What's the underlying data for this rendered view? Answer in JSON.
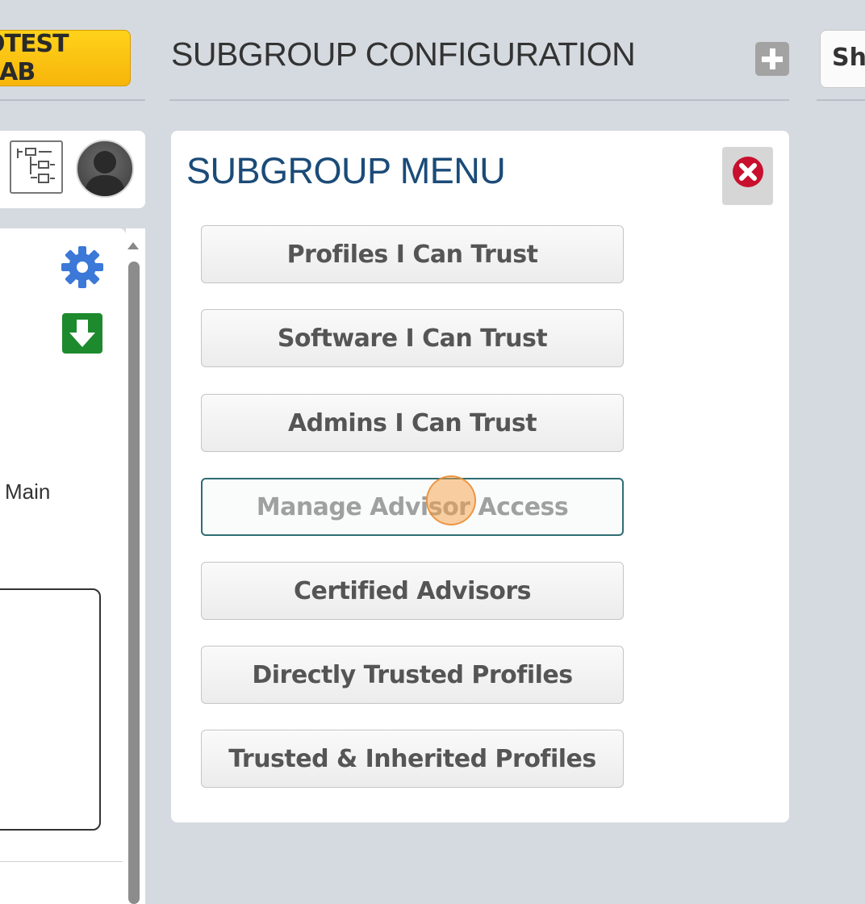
{
  "left_strip": {
    "lab_badge": "OTEST LAB",
    "main_label": "Main"
  },
  "header": {
    "title": "SUBGROUP CONFIGURATION",
    "add_icon": "plus-icon",
    "show_button_label": "Sh"
  },
  "menu": {
    "title": "SUBGROUP MENU",
    "close_icon": "close-icon",
    "buttons": [
      {
        "label": "Profiles I Can Trust",
        "active": false
      },
      {
        "label": "Software I Can Trust",
        "active": false
      },
      {
        "label": "Admins I Can Trust",
        "active": false
      },
      {
        "label": "Manage Advisor Access",
        "active": true
      },
      {
        "label": "Certified Advisors",
        "active": false
      },
      {
        "label": "Directly Trusted Profiles",
        "active": false
      },
      {
        "label": "Trusted & Inherited Profiles",
        "active": false
      }
    ]
  },
  "colors": {
    "background": "#d5dae0",
    "badge": "#f7b50a",
    "menu_title": "#1b4b78",
    "close_red": "#c8102e",
    "active_border": "#2f6d73"
  }
}
